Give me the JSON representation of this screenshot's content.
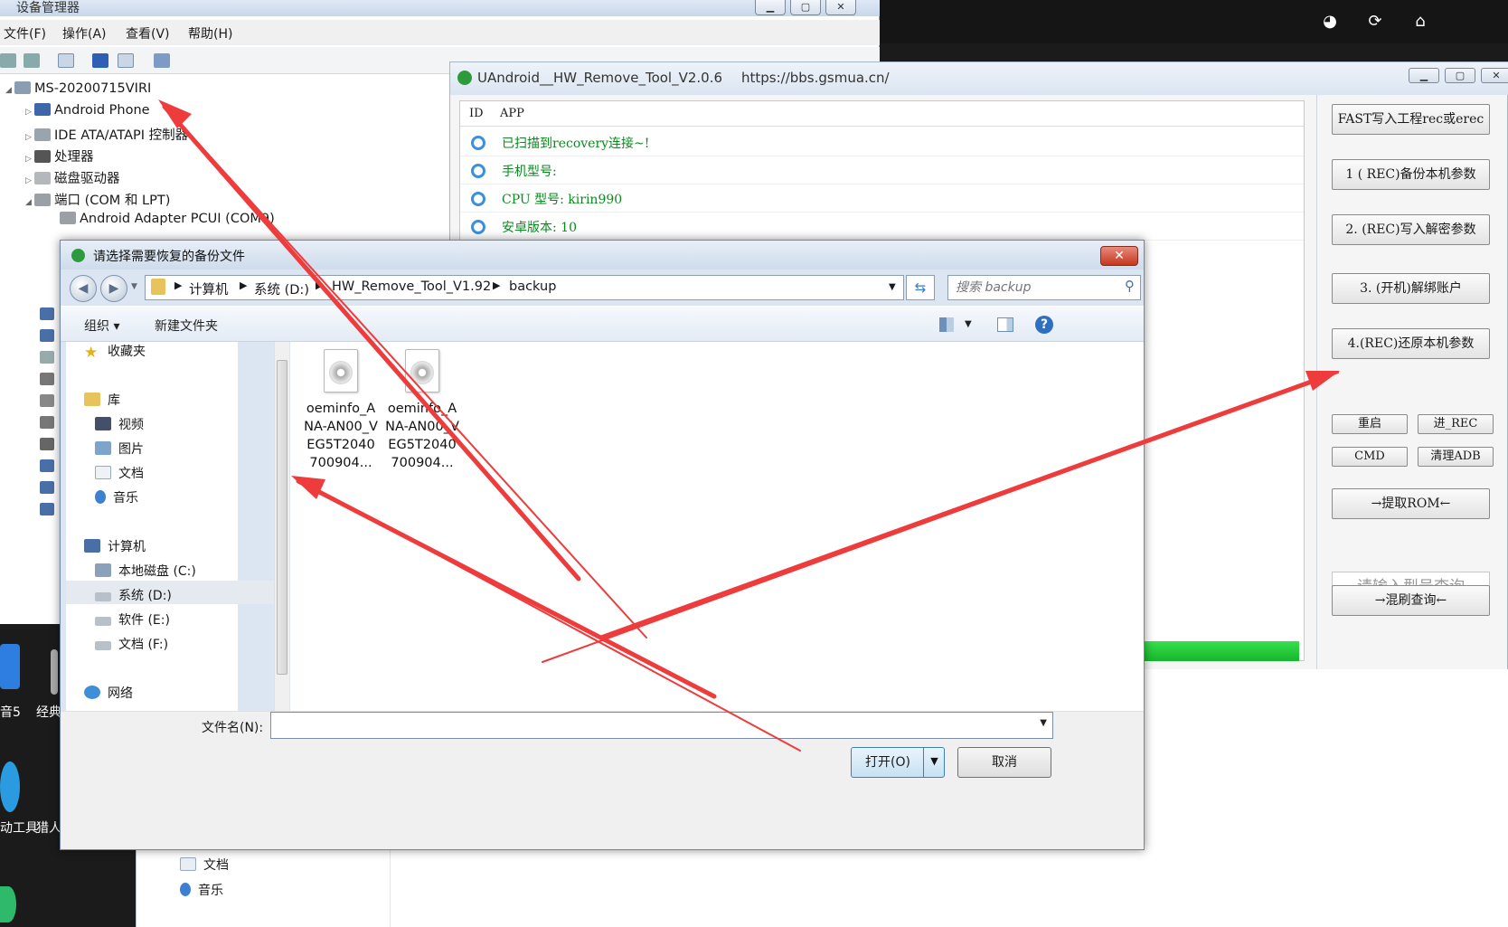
{
  "colors": {
    "arrow": "#ee3b3b",
    "log_text": "#0a8a1e",
    "progress": "#22c73a",
    "accent": "#3b8fe0"
  },
  "top_toolbar": {
    "icons": [
      "globe-icon",
      "refresh-icon",
      "home-icon"
    ]
  },
  "device_manager": {
    "title": "设备管理器",
    "menu": [
      "文件(F)",
      "操作(A)",
      "查看(V)",
      "帮助(H)"
    ],
    "tree": {
      "root": "MS-20200715VIRI",
      "items": [
        "Android Phone",
        "IDE ATA/ATAPI 控制器",
        "处理器",
        "磁盘驱动器",
        "端口 (COM 和 LPT)",
        "Android Adapter PCUI (COM9)"
      ]
    }
  },
  "tool_window": {
    "title": "UAndroid__HW_Remove_Tool_V2.0.6",
    "url": "https://bbs.gsmua.cn/",
    "grid_headers": [
      "ID",
      "APP"
    ],
    "log": [
      "已扫描到recovery连接~!",
      "手机型号:",
      "CPU 型号: kirin990",
      "安卓版本: 10"
    ],
    "buttons": [
      "FAST写入工程rec或erec",
      "1 ( REC)备份本机参数",
      "2. (REC)写入解密参数",
      "3. (开机)解绑账户",
      "4.(REC)还原本机参数"
    ],
    "small_buttons": [
      "重启",
      "进_REC",
      "CMD",
      "清理ADB"
    ],
    "extract_rom": "→提取ROM←",
    "model_placeholder": "请输入型号查询",
    "flash_query": "→混刷查询←",
    "progress": 1.0
  },
  "desktop": {
    "labels": [
      "音5",
      "经典",
      "动工具",
      "猎人"
    ]
  },
  "explorer_bg": {
    "items": [
      "文档",
      "音乐"
    ]
  },
  "open_dialog": {
    "title": "请选择需要恢复的备份文件",
    "breadcrumb": [
      "计算机",
      "系统 (D:)",
      "HW_Remove_Tool_V1.92",
      "backup"
    ],
    "search_placeholder": "搜索 backup",
    "toolbar": {
      "organize": "组织 ▾",
      "new_folder": "新建文件夹"
    },
    "nav": {
      "favorites": "收藏夹",
      "library": "库",
      "library_items": [
        "视频",
        "图片",
        "文档",
        "音乐"
      ],
      "computer": "计算机",
      "drives": [
        "本地磁盘 (C:)",
        "系统 (D:)",
        "软件 (E:)",
        "文档 (F:)"
      ],
      "network": "网络"
    },
    "files": [
      "oeminfo_ANA-AN00_VEG5T2040700904...",
      "oeminfo_ANA-AN00_VEG5T2040700904..."
    ],
    "filename_label": "文件名(N):",
    "filename_value": "",
    "open_label": "打开(O)",
    "cancel_label": "取消"
  }
}
